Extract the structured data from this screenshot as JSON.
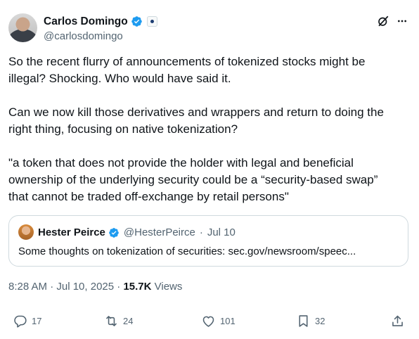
{
  "author": {
    "name": "Carlos Domingo",
    "handle": "@carlosdomingo"
  },
  "tweet": {
    "paragraphs": [
      "So the recent flurry of announcements of tokenized stocks might be\nillegal? Shocking. Who would have said it.",
      "Can we now kill those derivatives and wrappers and return to doing the\nright thing, focusing on native tokenization?",
      "\"a token that does not provide the holder with legal and beneficial\nownership of the underlying security could be a “security-based swap”\nthat cannot be traded off-exchange by retail persons\""
    ]
  },
  "quote": {
    "name": "Hester Peirce",
    "handle": "@HesterPeirce",
    "separator": "·",
    "date": "Jul 10",
    "text": "Some thoughts on tokenization of securities: sec.gov/newsroom/speec..."
  },
  "meta": {
    "timestamp": "8:28 AM · Jul 10, 2025 · ",
    "views_count": "15.7K",
    "views_label": " Views"
  },
  "actions": {
    "reply_count": "17",
    "repost_count": "24",
    "like_count": "101",
    "bookmark_count": "32"
  },
  "colors": {
    "verified": "#1d9bf0",
    "secondary_text": "#536471",
    "border": "#cfd9de"
  },
  "icons": [
    "verified-icon",
    "affiliate-badge-icon",
    "grok-icon",
    "more-icon",
    "reply-icon",
    "repost-icon",
    "like-icon",
    "bookmark-icon",
    "share-icon"
  ]
}
